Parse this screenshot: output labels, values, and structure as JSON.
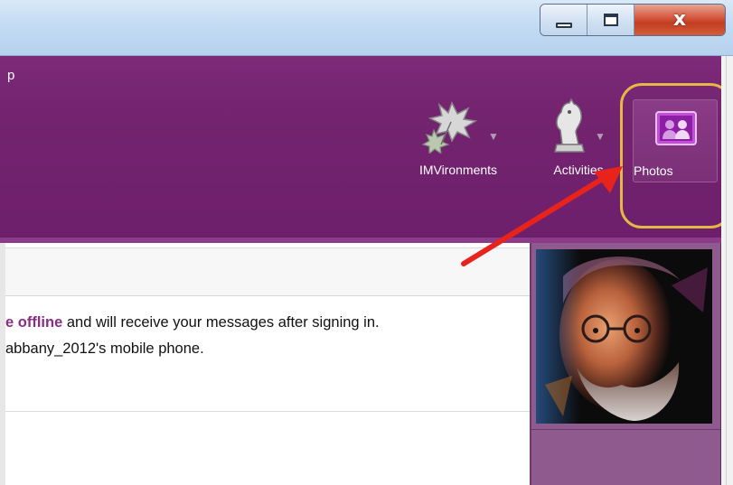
{
  "window": {
    "menu_fragment": "p",
    "controls": {
      "minimize_icon": "minimize-icon",
      "maximize_icon": "maximize-icon",
      "close_icon": "close-icon",
      "close_glyph": "x"
    }
  },
  "toolbar": {
    "items": [
      {
        "label": "IMVironments",
        "icon": "imvironments-leaves-icon",
        "has_dropdown": true
      },
      {
        "label": "Activities",
        "icon": "chess-knight-icon",
        "has_dropdown": true
      },
      {
        "label": "Photos",
        "icon": "photos-icon",
        "has_dropdown": false,
        "highlighted": true
      }
    ]
  },
  "message": {
    "line1_bold": "e offline",
    "line1_rest": " and will receive your messages after signing in.",
    "line2": "abbany_2012's mobile phone."
  },
  "avatar": {
    "icon": "contact-avatar-portrait"
  },
  "annotation": {
    "highlight_color": "#e5b845",
    "arrow_color": "#e8231b"
  },
  "colors": {
    "toolbar_purple": "#74246f",
    "panel_purple": "#8f5a8d",
    "offline_text": "#8a2d84"
  }
}
